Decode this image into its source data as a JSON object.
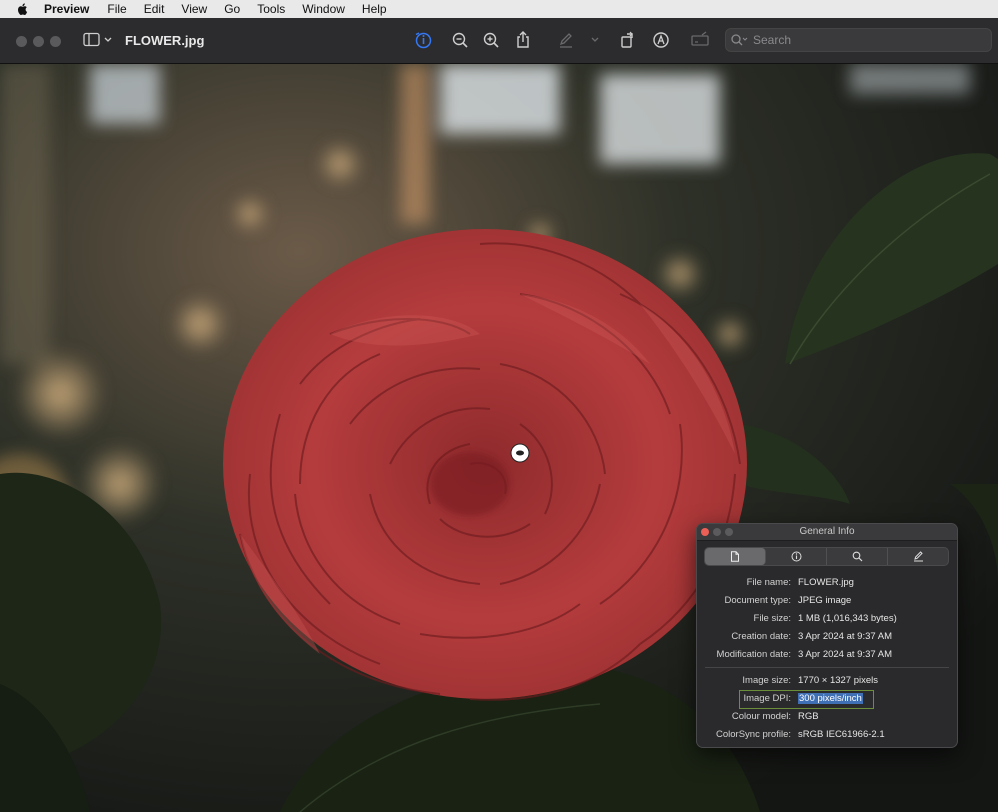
{
  "menubar": {
    "app_name": "Preview",
    "items": [
      "File",
      "Edit",
      "View",
      "Go",
      "Tools",
      "Window",
      "Help"
    ]
  },
  "toolbar": {
    "document_title": "FLOWER.jpg",
    "search_placeholder": "Search",
    "buttons": [
      "sidebar-toggle",
      "info",
      "zoom-out",
      "zoom-in",
      "share",
      "markup",
      "rotate",
      "annotate",
      "form-fill"
    ]
  },
  "info_panel": {
    "title": "General Info",
    "tabs": [
      "general-doc-icon",
      "info-icon",
      "search-icon",
      "pen-icon"
    ],
    "rows": [
      {
        "label": "File name:",
        "value": "FLOWER.jpg"
      },
      {
        "label": "Document type:",
        "value": "JPEG image"
      },
      {
        "label": "File size:",
        "value": "1 MB (1,016,343 bytes)"
      },
      {
        "label": "Creation date:",
        "value": "3 Apr 2024 at 9:37 AM"
      },
      {
        "label": "Modification date:",
        "value": "3 Apr 2024 at 9:37 AM"
      }
    ],
    "image_rows": [
      {
        "label": "Image size:",
        "value": "1770 × 1327 pixels"
      },
      {
        "label": "Image DPI:",
        "value": "300 pixels/inch"
      },
      {
        "label": "Colour model:",
        "value": "RGB"
      },
      {
        "label": "ColorSync profile:",
        "value": "sRGB IEC61966-2.1"
      }
    ]
  },
  "colors": {
    "accent": "#3478f6",
    "highlight_border": "#6b8e3a",
    "selection": "#3f6fb5",
    "petal": "#b03a3a"
  }
}
